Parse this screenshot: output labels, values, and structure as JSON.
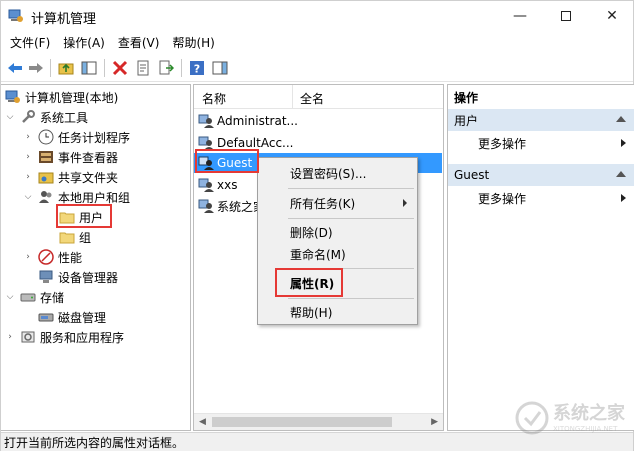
{
  "window": {
    "title": "计算机管理"
  },
  "menubar": [
    {
      "label": "文件(F)"
    },
    {
      "label": "操作(A)"
    },
    {
      "label": "查看(V)"
    },
    {
      "label": "帮助(H)"
    }
  ],
  "tree": {
    "items": [
      {
        "label": "计算机管理(本地)",
        "icon": "computer-management-icon",
        "expand": ""
      },
      {
        "label": "系统工具",
        "icon": "tools-icon",
        "expand": "expanded"
      },
      {
        "label": "任务计划程序",
        "icon": "clock-icon",
        "expand": "collapsed"
      },
      {
        "label": "事件查看器",
        "icon": "event-viewer-icon",
        "expand": "collapsed"
      },
      {
        "label": "共享文件夹",
        "icon": "shared-folder-icon",
        "expand": "collapsed"
      },
      {
        "label": "本地用户和组",
        "icon": "users-icon",
        "expand": "expanded"
      },
      {
        "label": "用户",
        "icon": "folder-icon",
        "expand": ""
      },
      {
        "label": "组",
        "icon": "folder-icon",
        "expand": ""
      },
      {
        "label": "性能",
        "icon": "performance-icon",
        "expand": "collapsed"
      },
      {
        "label": "设备管理器",
        "icon": "device-manager-icon",
        "expand": ""
      },
      {
        "label": "存储",
        "icon": "storage-icon",
        "expand": "expanded"
      },
      {
        "label": "磁盘管理",
        "icon": "disk-icon",
        "expand": ""
      },
      {
        "label": "服务和应用程序",
        "icon": "services-icon",
        "expand": "collapsed"
      }
    ]
  },
  "list": {
    "columns": {
      "name": "名称",
      "full_name": "全名"
    },
    "rows": [
      {
        "name": "Administrat...",
        "icon": "user-icon"
      },
      {
        "name": "DefaultAcc...",
        "icon": "user-icon"
      },
      {
        "name": "Guest",
        "icon": "user-icon",
        "selected": true
      },
      {
        "name": "xxs",
        "icon": "user-icon"
      },
      {
        "name": "系统之家",
        "icon": "user-icon"
      }
    ]
  },
  "context_menu": {
    "items": [
      {
        "label": "设置密码(S)..."
      },
      {
        "label": "所有任务(K)",
        "submenu": true
      },
      {
        "label": "删除(D)"
      },
      {
        "label": "重命名(M)"
      },
      {
        "label": "属性(R)",
        "bold": true
      },
      {
        "label": "帮助(H)"
      }
    ]
  },
  "actions": {
    "title": "操作",
    "sections": [
      {
        "title": "用户",
        "item": "更多操作"
      },
      {
        "title": "Guest",
        "item": "更多操作"
      }
    ]
  },
  "status": {
    "text": "打开当前所选内容的属性对话框。"
  },
  "watermark": {
    "text": "系统之家",
    "sub": "XITONGZHIJIA.NET"
  },
  "colors": {
    "selection": "#3399ff",
    "highlight": "#e53935",
    "section_bg": "#dbe7f3"
  }
}
